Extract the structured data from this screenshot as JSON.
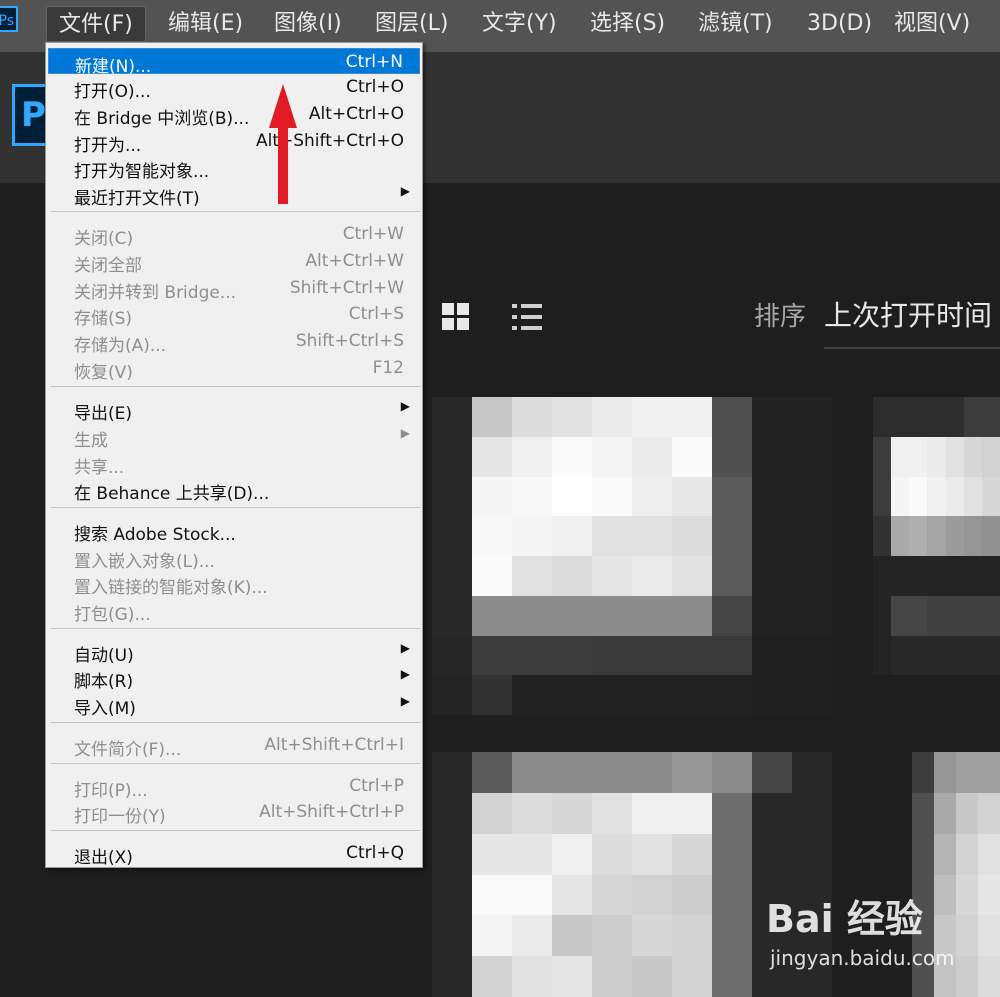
{
  "app_badge": "Ps",
  "home_logo_letter": "P",
  "menubar": {
    "items": [
      "文件(F)",
      "编辑(E)",
      "图像(I)",
      "图层(L)",
      "文字(Y)",
      "选择(S)",
      "滤镜(T)",
      "3D(D)",
      "视图(V)"
    ],
    "active_index": 0
  },
  "toolbar": {
    "grid_view_icon": "grid-icon",
    "list_view_icon": "list-icon",
    "sort_label": "排序",
    "sort_value": "上次打开时间"
  },
  "file_menu": {
    "items": [
      {
        "label": "新建(N)...",
        "shortcut": "Ctrl+N",
        "state": "selected"
      },
      {
        "label": "打开(O)...",
        "shortcut": "Ctrl+O",
        "state": "enabled"
      },
      {
        "label": "在 Bridge 中浏览(B)...",
        "shortcut": "Alt+Ctrl+O",
        "state": "enabled"
      },
      {
        "label": "打开为...",
        "shortcut": "Alt+Shift+Ctrl+O",
        "state": "enabled"
      },
      {
        "label": "打开为智能对象...",
        "shortcut": "",
        "state": "enabled"
      },
      {
        "label": "最近打开文件(T)",
        "shortcut": "",
        "state": "enabled",
        "submenu": true
      },
      {
        "label": "关闭(C)",
        "shortcut": "Ctrl+W",
        "state": "disabled"
      },
      {
        "label": "关闭全部",
        "shortcut": "Alt+Ctrl+W",
        "state": "disabled"
      },
      {
        "label": "关闭并转到 Bridge...",
        "shortcut": "Shift+Ctrl+W",
        "state": "disabled"
      },
      {
        "label": "存储(S)",
        "shortcut": "Ctrl+S",
        "state": "disabled"
      },
      {
        "label": "存储为(A)...",
        "shortcut": "Shift+Ctrl+S",
        "state": "disabled"
      },
      {
        "label": "恢复(V)",
        "shortcut": "F12",
        "state": "disabled"
      },
      {
        "label": "导出(E)",
        "shortcut": "",
        "state": "enabled",
        "submenu": true
      },
      {
        "label": "生成",
        "shortcut": "",
        "state": "disabled",
        "submenu": true
      },
      {
        "label": "共享...",
        "shortcut": "",
        "state": "disabled"
      },
      {
        "label": "在 Behance 上共享(D)...",
        "shortcut": "",
        "state": "enabled"
      },
      {
        "label": "搜索 Adobe Stock...",
        "shortcut": "",
        "state": "enabled"
      },
      {
        "label": "置入嵌入对象(L)...",
        "shortcut": "",
        "state": "disabled"
      },
      {
        "label": "置入链接的智能对象(K)...",
        "shortcut": "",
        "state": "disabled"
      },
      {
        "label": "打包(G)...",
        "shortcut": "",
        "state": "disabled"
      },
      {
        "label": "自动(U)",
        "shortcut": "",
        "state": "enabled",
        "submenu": true
      },
      {
        "label": "脚本(R)",
        "shortcut": "",
        "state": "enabled",
        "submenu": true
      },
      {
        "label": "导入(M)",
        "shortcut": "",
        "state": "enabled",
        "submenu": true
      },
      {
        "label": "文件简介(F)...",
        "shortcut": "Alt+Shift+Ctrl+I",
        "state": "disabled"
      },
      {
        "label": "打印(P)...",
        "shortcut": "Ctrl+P",
        "state": "disabled"
      },
      {
        "label": "打印一份(Y)",
        "shortcut": "Alt+Shift+Ctrl+P",
        "state": "disabled"
      },
      {
        "label": "退出(X)",
        "shortcut": "Ctrl+Q",
        "state": "enabled"
      }
    ]
  },
  "watermark": {
    "brand": "Bai 经验",
    "url": "jingyan.baidu.com"
  },
  "colors": {
    "menubar_bg": "#535353",
    "menu_bg": "#f0f0f0",
    "selection": "#0078d7",
    "ps_blue": "#31a8ff",
    "arrow_red": "#e01b24"
  }
}
